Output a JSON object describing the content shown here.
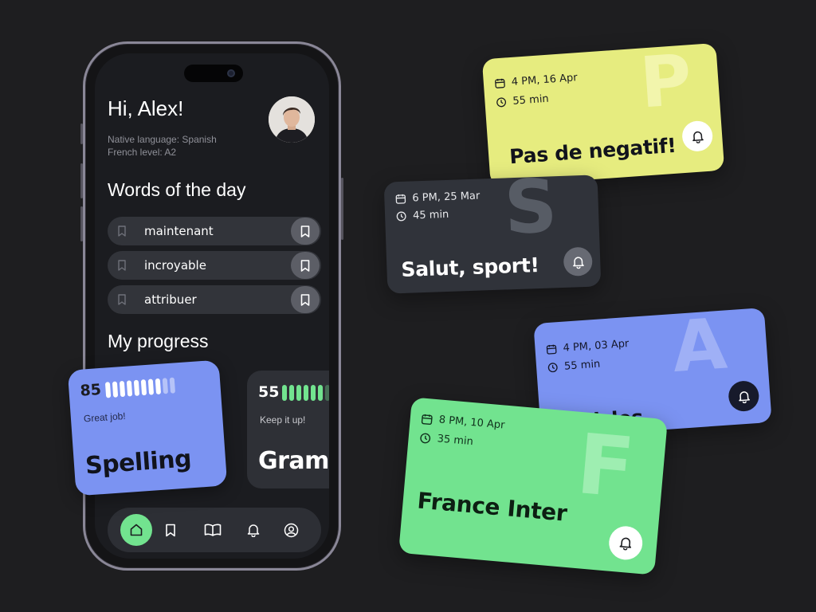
{
  "colors": {
    "background": "#1e1e20",
    "blue": "#7b93f2",
    "green": "#72e38f",
    "yellow": "#e6ec7f",
    "dark_card": "#30333a"
  },
  "profile": {
    "greeting": "Hi, Alex!",
    "native_language": "Native language: Spanish",
    "french_level": "French level: A2"
  },
  "words_of_day": {
    "title": "Words of the day",
    "words": [
      "maintenant",
      "incroyable",
      "attribuer"
    ]
  },
  "progress": {
    "title": "My progress",
    "cards": [
      {
        "score": "85",
        "level": 0.8,
        "note": "Great job!",
        "label": "Spelling"
      },
      {
        "score": "55",
        "level": 0.6,
        "note": "Keep it up!",
        "label": "Gramm"
      }
    ]
  },
  "nav": {
    "items": [
      "home-icon",
      "bookmark-icon",
      "book-icon",
      "bell-icon",
      "profile-icon"
    ],
    "active": "home-icon"
  },
  "lessons": [
    {
      "date": "4 PM, 16 Apr",
      "duration": "55 min",
      "title": "Pas de negatif!",
      "letter": "P"
    },
    {
      "date": "6 PM, 25 Mar",
      "duration": "45 min",
      "title": "Salut, sport!",
      "letter": "S"
    },
    {
      "date": "4 PM, 03 Apr",
      "duration": "55 min",
      "title": "Articles",
      "letter": "A"
    },
    {
      "date": "8 PM, 10 Apr",
      "duration": "35 min",
      "title": "France Inter",
      "letter": "F"
    }
  ]
}
